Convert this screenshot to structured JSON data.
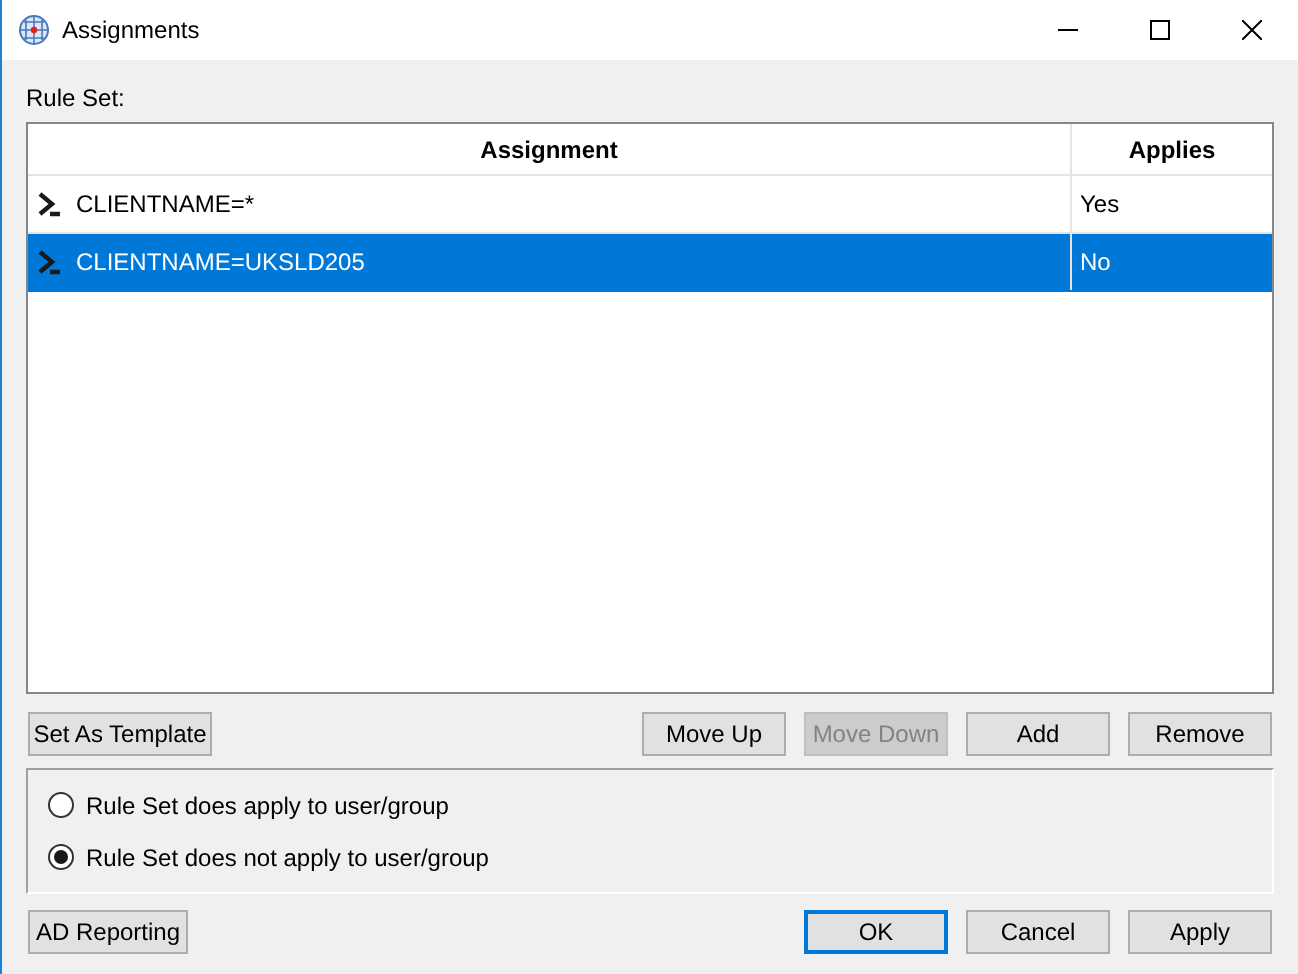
{
  "window": {
    "title": "Assignments"
  },
  "rule_set_label": "Rule Set:",
  "table": {
    "columns": [
      "Assignment",
      "Applies"
    ],
    "rows": [
      {
        "assignment": "CLIENTNAME=*",
        "applies": "Yes",
        "selected": false
      },
      {
        "assignment": "CLIENTNAME=UKSLD205",
        "applies": "No",
        "selected": true
      }
    ]
  },
  "left_button": {
    "label": "Set As Template",
    "disabled": false
  },
  "list_buttons": [
    {
      "label": "Move Up",
      "disabled": false
    },
    {
      "label": "Move Down",
      "disabled": true
    },
    {
      "label": "Add",
      "disabled": false
    },
    {
      "label": "Remove",
      "disabled": false
    }
  ],
  "radios": [
    {
      "label": "Rule Set does apply to user/group",
      "selected": false
    },
    {
      "label": "Rule Set does not apply to user/group",
      "selected": true
    }
  ],
  "bottom_left_button": {
    "label": "AD Reporting",
    "disabled": false
  },
  "dialog_buttons": [
    {
      "label": "OK",
      "default": true
    },
    {
      "label": "Cancel",
      "default": false
    },
    {
      "label": "Apply",
      "default": false
    }
  ]
}
